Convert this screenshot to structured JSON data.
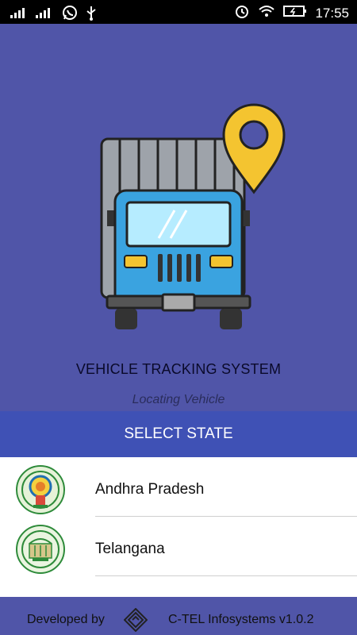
{
  "status_bar": {
    "time": "17:55",
    "icons": [
      "signal-icon",
      "signal-2-icon",
      "whatsapp-icon",
      "usb-icon",
      "alarm-icon",
      "wifi-icon",
      "battery-icon"
    ]
  },
  "hero": {
    "title": "VEHICLE TRACKING SYSTEM",
    "status": "Locating Vehicle"
  },
  "select_state": {
    "header": "SELECT STATE",
    "items": [
      {
        "label": "Andhra Pradesh",
        "icon": "andhra-pradesh-emblem-icon"
      },
      {
        "label": "Telangana",
        "icon": "telangana-emblem-icon"
      }
    ]
  },
  "footer": {
    "developed_by": "Developed by",
    "company": "C-TEL Infosystems v1.0.2"
  },
  "colors": {
    "background": "#5055a8",
    "header": "#3f51b5",
    "pin": "#f4c430",
    "truck_body": "#3aa3e0"
  }
}
